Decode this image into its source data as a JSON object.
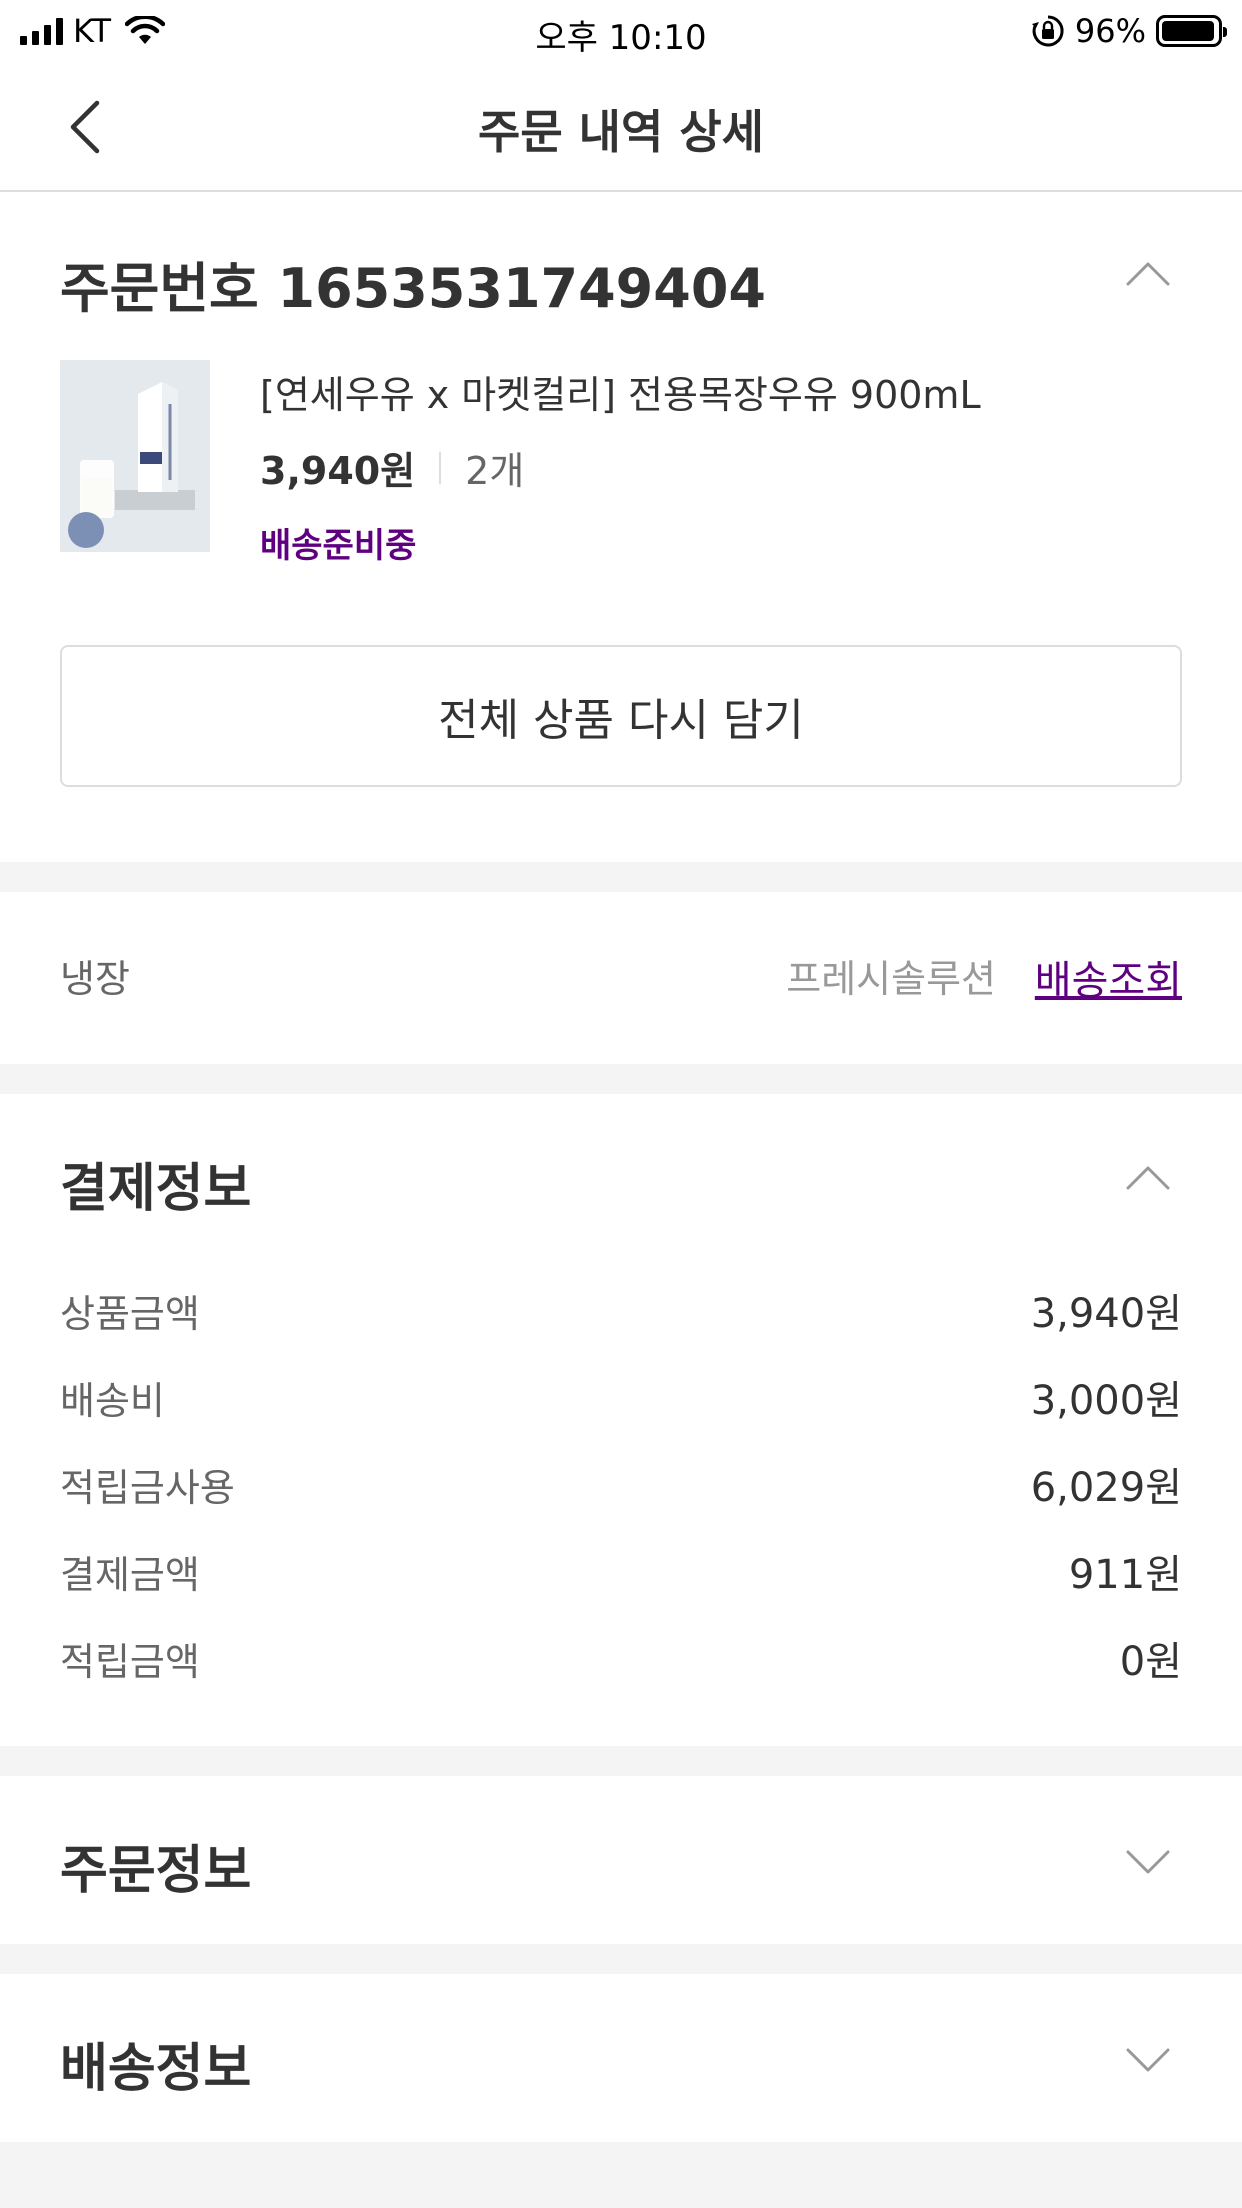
{
  "status_bar": {
    "carrier": "KT",
    "time": "오후 10:10",
    "battery": "96%",
    "battery_level": 0.96
  },
  "header": {
    "title": "주문 내역 상세"
  },
  "order": {
    "number_label": "주문번호 1653531749404",
    "product": {
      "name": "[연세우유 x 마켓컬리] 전용목장우유 900mL",
      "price": "3,940원",
      "quantity": "2개",
      "status": "배송준비중"
    },
    "reorder_button": "전체 상품 다시 담기"
  },
  "delivery": {
    "storage_type": "냉장",
    "courier": "프레시솔루션",
    "track_link": "배송조회"
  },
  "payment": {
    "title": "결제정보",
    "rows": [
      {
        "label": "상품금액",
        "value": "3,940원"
      },
      {
        "label": "배송비",
        "value": "3,000원"
      },
      {
        "label": "적립금사용",
        "value": "6,029원"
      },
      {
        "label": "결제금액",
        "value": "911원"
      },
      {
        "label": "적립금액",
        "value": "0원"
      }
    ]
  },
  "order_info": {
    "title": "주문정보"
  },
  "shipping_info": {
    "title": "배송정보"
  },
  "colors": {
    "accent": "#5f0080",
    "divider": "#f4f4f4",
    "border": "#dddddd"
  }
}
